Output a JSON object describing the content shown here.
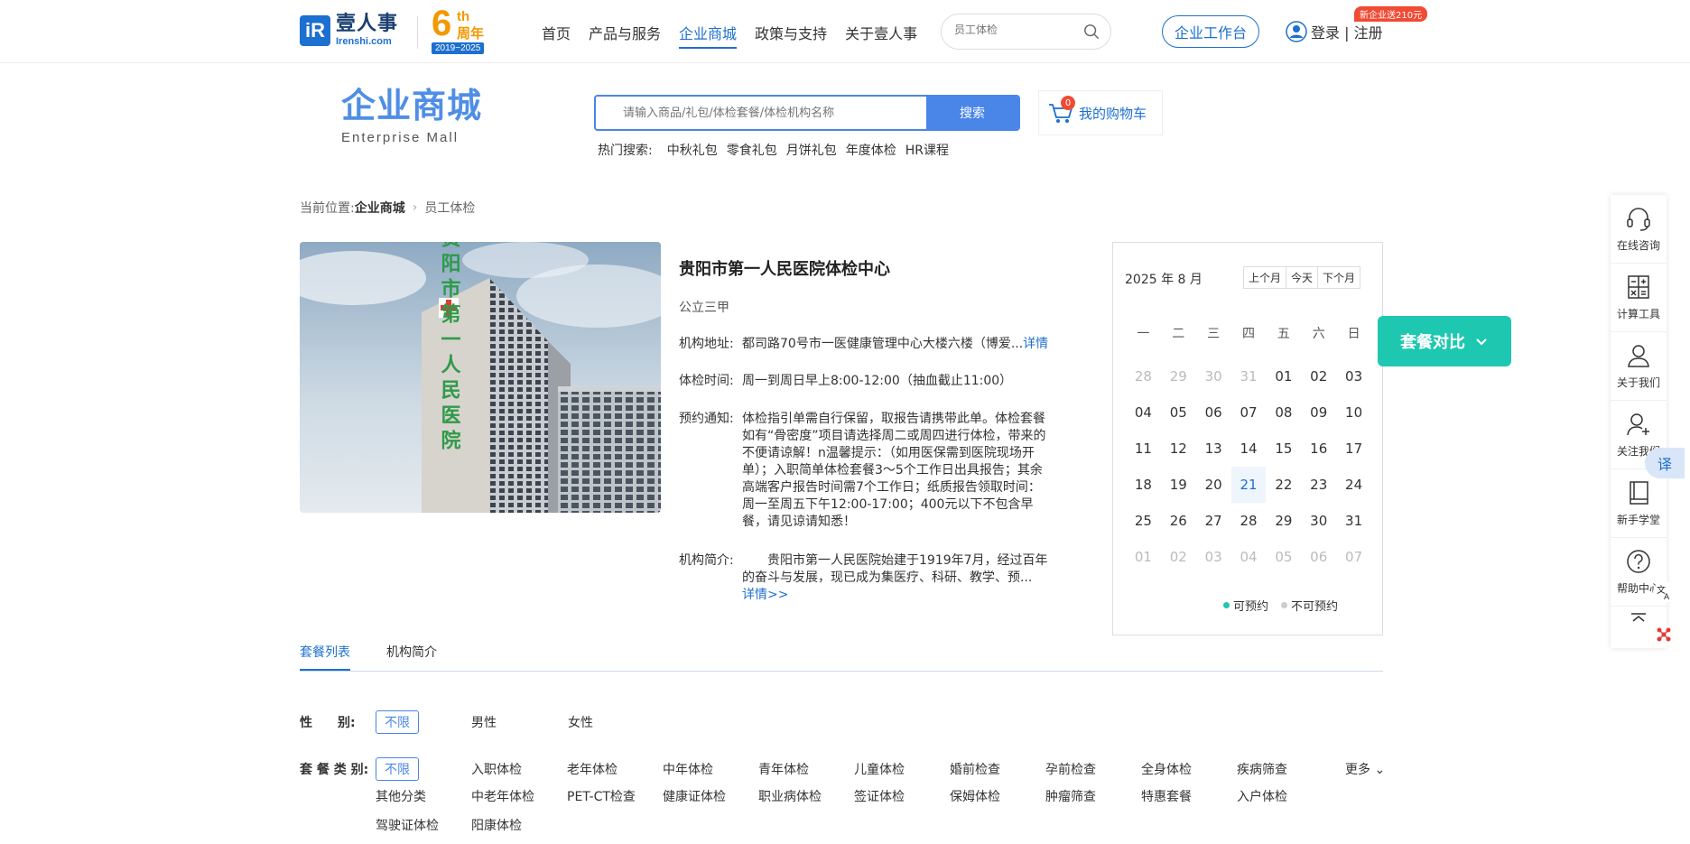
{
  "header": {
    "logo_cn": "壹人事",
    "logo_en": "Irenshi.com",
    "logo_mark": "iR",
    "anniv_num": "6",
    "anniv_th": "th",
    "anniv_zn": "周年",
    "anniv_years": "2019~2025",
    "nav": [
      "首页",
      "产品与服务",
      "企业商城",
      "政策与支持",
      "关于壹人事"
    ],
    "search_placeholder": "员工体检",
    "workbench": "企业工作台",
    "login": "登录 | 注册",
    "promo": "新企业送210元"
  },
  "mall": {
    "title_cn": "企业商城",
    "title_en": "Enterprise  Mall",
    "search_placeholder": "请输入商品/礼包/体检套餐/体检机构名称",
    "search_button": "搜索",
    "cart_count": "0",
    "cart_label": "我的购物车",
    "hot_label": "热门搜索:",
    "hot_tags": [
      "中秋礼包",
      "零食礼包",
      "月饼礼包",
      "年度体检",
      "HR课程"
    ]
  },
  "breadcrumb": {
    "prefix": "当前位置:",
    "level1": "企业商城",
    "level2": "员工体检"
  },
  "hospital": {
    "name": "贵阳市第一人民医院体检中心",
    "level": "公立三甲",
    "address_label": "机构地址:",
    "address": "都司路70号市一医健康管理中心大楼六楼（博爱...",
    "address_link": "详情",
    "time_label": "体检时间:",
    "time": "周一到周日早上8:00-12:00（抽血截止11:00）",
    "notice_label": "预约通知:",
    "notice": "体检指引单需自行保留，取报告请携带此单。体检套餐如有“骨密度”项目请选择周二或周四进行体检，带来的不便请谅解！n温馨提示：（如用医保需到医院现场开单）；入职简单体检套餐3～5个工作日出具报告；其余高端客户报告时间需7个工作日；纸质报告领取时间：周一至周五下午12:00-17:00；400元以下不包含早餐，请见谅请知悉！",
    "intro_label": "机构简介:",
    "intro": "　　贵阳市第一人民医院始建于1919年7月，经过百年的奋斗与发展，现已成为集医疗、科研、教学、预...",
    "intro_link": "详情>>",
    "building_sign": "贵阳市第一人民医院"
  },
  "calendar": {
    "title": "2025 年 8 月",
    "prev": "上个月",
    "today": "今天",
    "next": "下个月",
    "weekdays": [
      "一",
      "二",
      "三",
      "四",
      "五",
      "六",
      "日"
    ],
    "days": [
      {
        "d": "28",
        "m": true
      },
      {
        "d": "29",
        "m": true
      },
      {
        "d": "30",
        "m": true
      },
      {
        "d": "31",
        "m": true
      },
      {
        "d": "01"
      },
      {
        "d": "02"
      },
      {
        "d": "03"
      },
      {
        "d": "04"
      },
      {
        "d": "05"
      },
      {
        "d": "06"
      },
      {
        "d": "07"
      },
      {
        "d": "08"
      },
      {
        "d": "09"
      },
      {
        "d": "10"
      },
      {
        "d": "11"
      },
      {
        "d": "12"
      },
      {
        "d": "13"
      },
      {
        "d": "14"
      },
      {
        "d": "15"
      },
      {
        "d": "16"
      },
      {
        "d": "17"
      },
      {
        "d": "18"
      },
      {
        "d": "19"
      },
      {
        "d": "20"
      },
      {
        "d": "21",
        "t": true
      },
      {
        "d": "22"
      },
      {
        "d": "23"
      },
      {
        "d": "24"
      },
      {
        "d": "25"
      },
      {
        "d": "26"
      },
      {
        "d": "27"
      },
      {
        "d": "28"
      },
      {
        "d": "29"
      },
      {
        "d": "30"
      },
      {
        "d": "31"
      },
      {
        "d": "01",
        "m": true
      },
      {
        "d": "02",
        "m": true
      },
      {
        "d": "03",
        "m": true
      },
      {
        "d": "04",
        "m": true
      },
      {
        "d": "05",
        "m": true
      },
      {
        "d": "06",
        "m": true
      },
      {
        "d": "07",
        "m": true
      }
    ],
    "legend_available": "可预约",
    "legend_unavailable": "不可预约",
    "color_available": "#1ec8b0",
    "color_unavailable": "#cccccc"
  },
  "compare_button": "套餐对比",
  "sidebar": [
    "在线咨询",
    "计算工具",
    "关于我们",
    "关注我们",
    "新手学堂",
    "帮助中心"
  ],
  "translate": "译",
  "tabs": [
    "套餐列表",
    "机构简介"
  ],
  "filters": {
    "gender_label": "性　　别:",
    "gender": [
      "不限",
      "男性",
      "女性"
    ],
    "type_label": "套 餐 类 别:",
    "types": [
      "不限",
      "入职体检",
      "老年体检",
      "中年体检",
      "青年体检",
      "儿童体检",
      "婚前检查",
      "孕前检查",
      "全身体检",
      "疾病筛查",
      "其他分类",
      "中老年体检",
      "PET-CT检查",
      "健康证体检",
      "职业病体检",
      "签证体检",
      "保姆体检",
      "肿瘤筛查",
      "特惠套餐",
      "入户体检",
      "驾驶证体检",
      "阳康体检"
    ],
    "more": "更多"
  }
}
